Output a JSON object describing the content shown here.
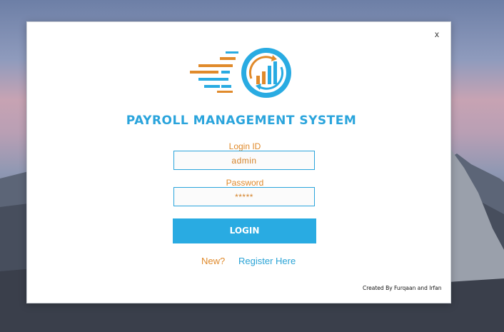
{
  "window": {
    "close_label": "x",
    "title": "PAYROLL MANAGEMENT SYSTEM"
  },
  "login_form": {
    "login_id_label": "Login ID",
    "login_id_value": "admin",
    "password_label": "Password",
    "password_value": "*****",
    "login_button_label": "LOGIN",
    "new_prompt": "New?",
    "register_link": "Register Here"
  },
  "footer": {
    "credit": "Created By Furqaan and Irfan"
  },
  "colors": {
    "accent_blue": "#29abe2",
    "accent_orange": "#e08a2b"
  },
  "icons": {
    "logo": "payroll-chart-logo",
    "close": "close-icon"
  }
}
